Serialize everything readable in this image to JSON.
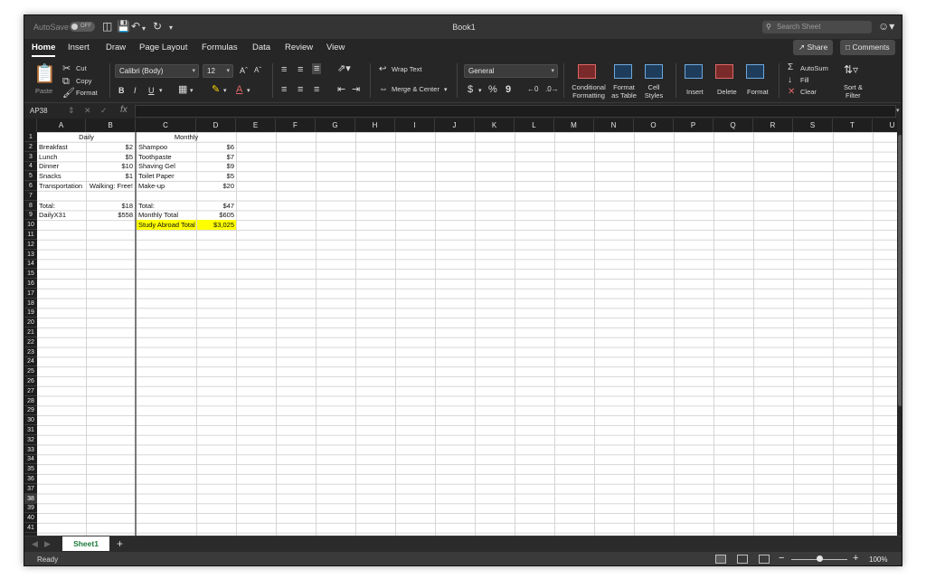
{
  "titlebar": {
    "autosave_label": "AutoSave",
    "autosave_state": "OFF",
    "document_title": "Book1",
    "search_placeholder": "Search Sheet"
  },
  "ribbon_tabs": [
    "Home",
    "Insert",
    "Draw",
    "Page Layout",
    "Formulas",
    "Data",
    "Review",
    "View"
  ],
  "active_tab": "Home",
  "top_buttons": {
    "share": "Share",
    "comments": "Comments"
  },
  "clipboard": {
    "paste": "Paste",
    "cut": "Cut",
    "copy": "Copy",
    "format": "Format"
  },
  "font": {
    "name": "Calibri (Body)",
    "size": "12",
    "bold": "B",
    "italic": "I",
    "underline": "U"
  },
  "alignment": {
    "wrap_text": "Wrap Text",
    "merge_center": "Merge & Center"
  },
  "number": {
    "format": "General",
    "currency": "$",
    "percent": "%",
    "comma": "9"
  },
  "styles": {
    "conditional_formatting": [
      "Conditional",
      "Formatting"
    ],
    "format_as_table": [
      "Format",
      "as Table"
    ],
    "cell_styles": [
      "Cell",
      "Styles"
    ]
  },
  "cells_group": {
    "insert": "Insert",
    "delete": "Delete",
    "format": "Format"
  },
  "editing": {
    "autosum": "AutoSum",
    "fill": "Fill",
    "clear": "Clear",
    "sort_filter": [
      "Sort &",
      "Filter"
    ]
  },
  "formula_bar": {
    "name_box": "AP38",
    "fx": "fx",
    "content": ""
  },
  "columns": [
    "A",
    "B",
    "C",
    "D",
    "E",
    "F",
    "G",
    "H",
    "I",
    "J",
    "K",
    "L",
    "M",
    "N",
    "O",
    "P",
    "Q",
    "R",
    "S",
    "T",
    "U"
  ],
  "rows": [
    "1",
    "2",
    "3",
    "4",
    "5",
    "6",
    "7",
    "8",
    "9",
    "10",
    "11",
    "12",
    "13",
    "14",
    "15",
    "16",
    "17",
    "18",
    "19",
    "20",
    "21",
    "22",
    "23",
    "24",
    "25",
    "26",
    "27",
    "28",
    "29",
    "30",
    "31",
    "32",
    "33",
    "34",
    "35",
    "36",
    "37",
    "38",
    "39",
    "40",
    "41"
  ],
  "selected_row": "38",
  "sheet": {
    "A1B1": "Daily",
    "C1D1": "Monthly",
    "A2": "Breakfast",
    "B2": "$2",
    "C2": "Shampoo",
    "D2": "$6",
    "A3": "Lunch",
    "B3": "$5",
    "C3": "Toothpaste",
    "D3": "$7",
    "A4": "Dinner",
    "B4": "$10",
    "C4": "Shaving Gel",
    "D4": "$9",
    "A5": "Snacks",
    "B5": "$1",
    "C5": "Toilet Paper",
    "D5": "$5",
    "A6": "Transportation",
    "B6": "Walking: Free!",
    "C6": "Make-up",
    "D6": "$20",
    "A8": "Total:",
    "B8": "$18",
    "C8": "Total:",
    "D8": "$47",
    "A9": "DailyX31",
    "B9": "$558",
    "C9": "Monthly Total",
    "D9": "$605",
    "C10": "Study Abroad Total",
    "D10": "$3,025"
  },
  "highlight_color": "#ffff00",
  "sheet_tabs": [
    "Sheet1"
  ],
  "status": {
    "ready": "Ready",
    "zoom": "100%"
  }
}
